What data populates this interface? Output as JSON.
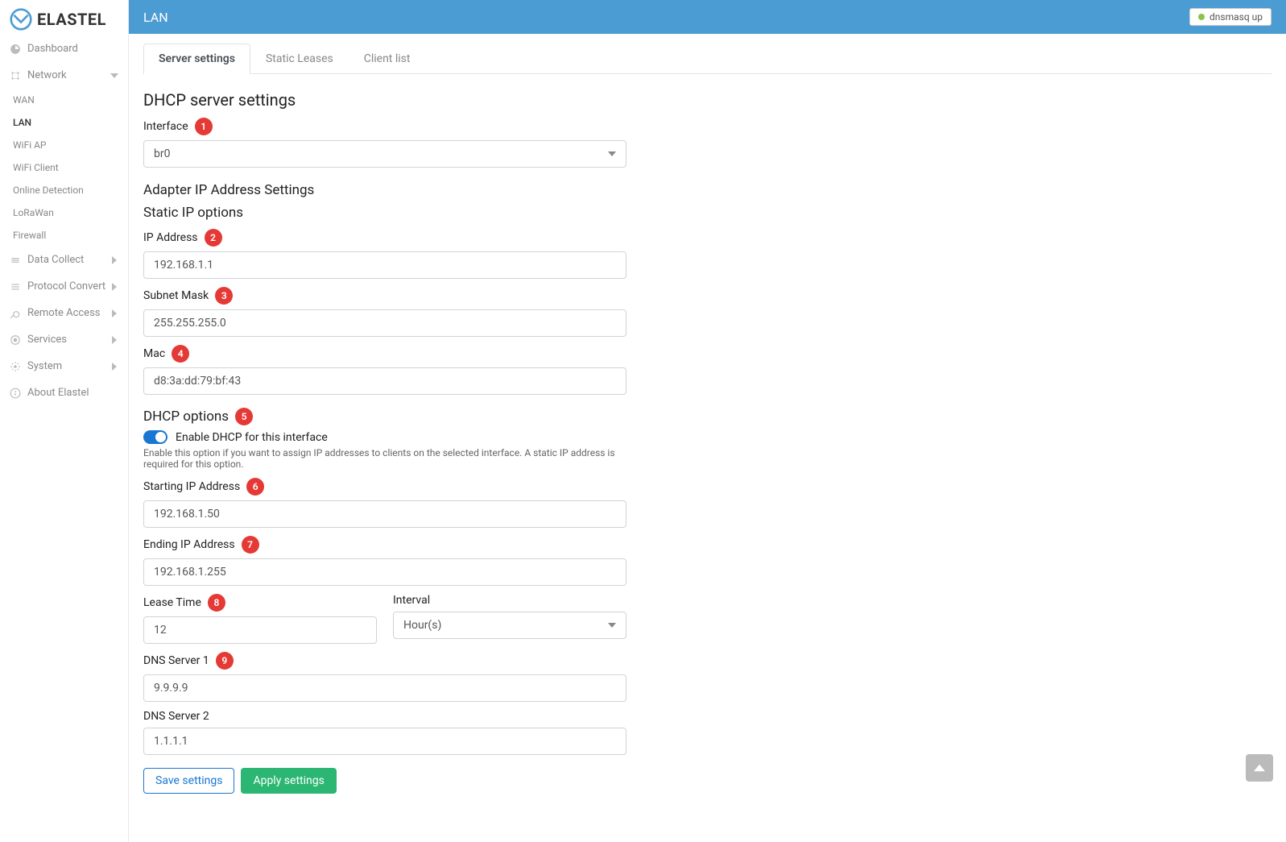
{
  "brand": "ELASTEL",
  "page_title": "LAN",
  "status": {
    "text": "dnsmasq up"
  },
  "sidebar": {
    "dashboard": "Dashboard",
    "network": {
      "label": "Network",
      "items": [
        "WAN",
        "LAN",
        "WiFi AP",
        "WiFi Client",
        "Online Detection",
        "LoRaWan",
        "Firewall"
      ],
      "active_index": 1
    },
    "data_collect": "Data Collect",
    "protocol_convert": "Protocol Convert",
    "remote_access": "Remote Access",
    "services": "Services",
    "system": "System",
    "about": "About Elastel"
  },
  "tabs": [
    "Server settings",
    "Static Leases",
    "Client list"
  ],
  "form": {
    "section_title": "DHCP server settings",
    "interface_label": "Interface",
    "interface_value": "br0",
    "adapter_heading": "Adapter IP Address Settings",
    "static_heading": "Static IP options",
    "ip_label": "IP Address",
    "ip_value": "192.168.1.1",
    "subnet_label": "Subnet Mask",
    "subnet_value": "255.255.255.0",
    "mac_label": "Mac",
    "mac_value": "d8:3a:dd:79:bf:43",
    "dhcp_heading": "DHCP options",
    "dhcp_toggle_label": "Enable DHCP for this interface",
    "dhcp_help": "Enable this option if you want to assign IP addresses to clients on the selected interface. A static IP address is required for this option.",
    "start_ip_label": "Starting IP Address",
    "start_ip_value": "192.168.1.50",
    "end_ip_label": "Ending IP Address",
    "end_ip_value": "192.168.1.255",
    "lease_label": "Lease Time",
    "lease_value": "12",
    "interval_label": "Interval",
    "interval_value": "Hour(s)",
    "dns1_label": "DNS Server 1",
    "dns1_value": "9.9.9.9",
    "dns2_label": "DNS Server 2",
    "dns2_value": "1.1.1.1",
    "save_btn": "Save settings",
    "apply_btn": "Apply settings"
  },
  "badges": [
    "1",
    "2",
    "3",
    "4",
    "5",
    "6",
    "7",
    "8",
    "9"
  ]
}
